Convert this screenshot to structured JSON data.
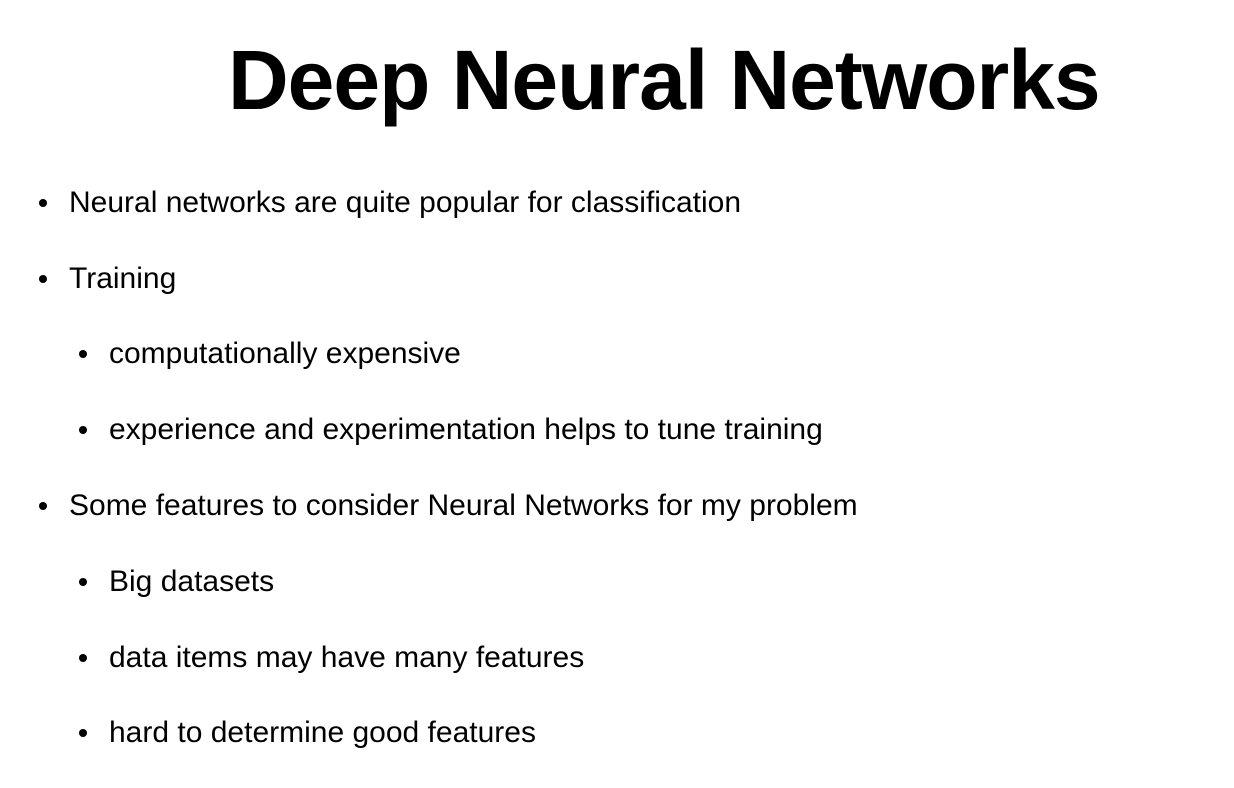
{
  "slide": {
    "title": "Deep Neural Networks",
    "bullets": [
      {
        "level": 1,
        "text": "Neural networks are quite popular for classification"
      },
      {
        "level": 1,
        "text": "Training"
      },
      {
        "level": 2,
        "text": "computationally expensive"
      },
      {
        "level": 2,
        "text": "experience and experimentation helps to tune training"
      },
      {
        "level": 1,
        "text": "Some features to consider Neural Networks for my problem"
      },
      {
        "level": 2,
        "text": "Big datasets"
      },
      {
        "level": 2,
        "text": "data items may have many features"
      },
      {
        "level": 2,
        "text": "hard to determine good features"
      }
    ]
  }
}
